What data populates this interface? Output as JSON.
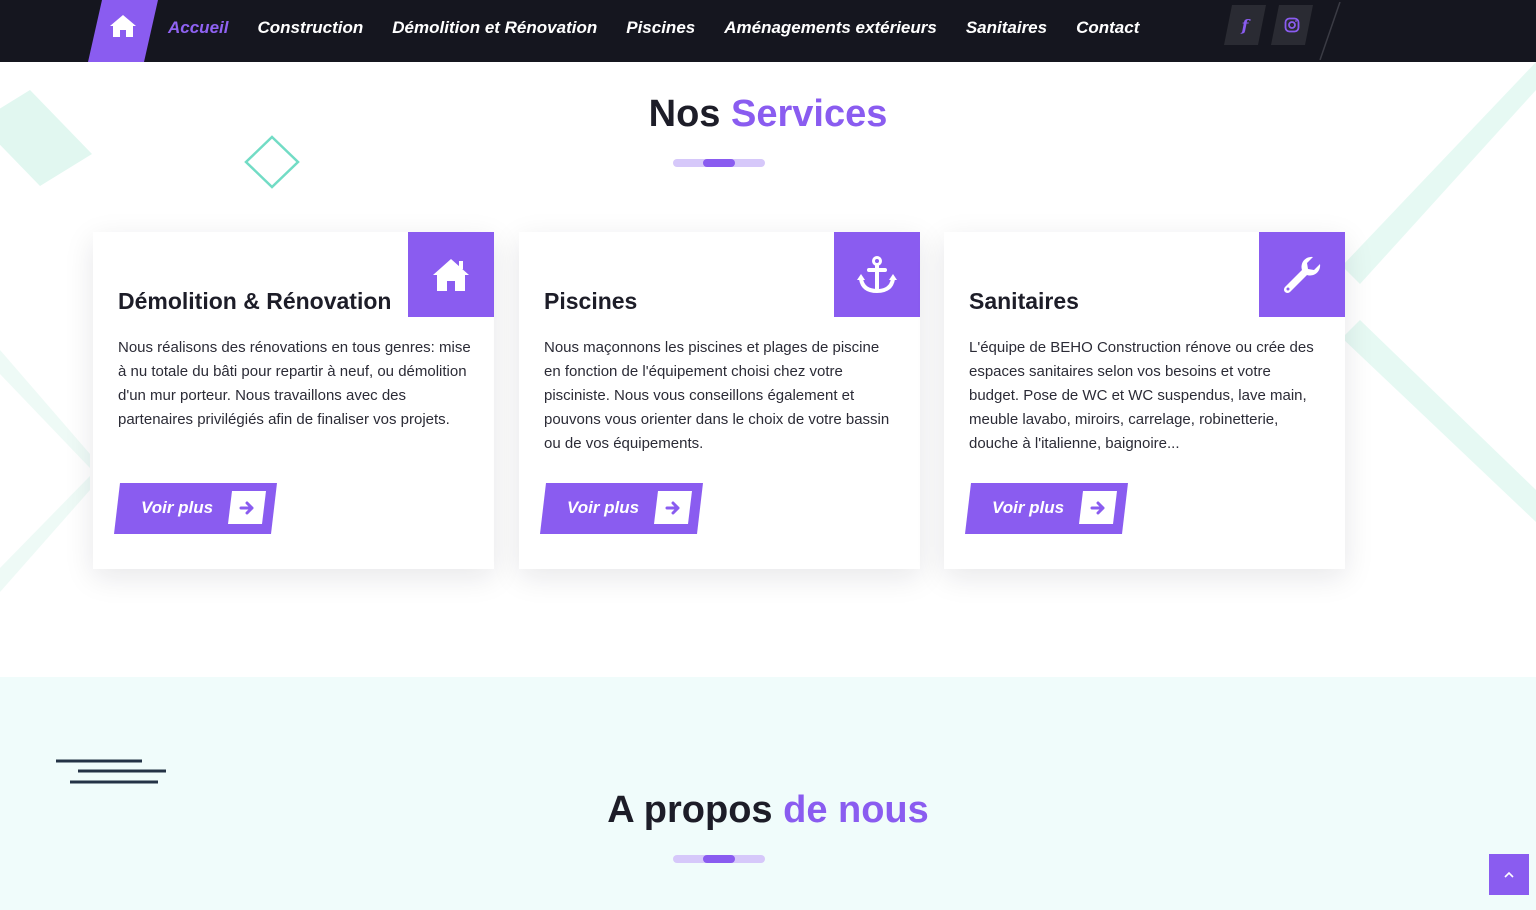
{
  "nav": {
    "home_icon": "home-icon",
    "links": [
      {
        "label": "Accueil"
      },
      {
        "label": "Construction"
      },
      {
        "label": "Démolition et Rénovation"
      },
      {
        "label": "Piscines"
      },
      {
        "label": "Aménagements extérieurs"
      },
      {
        "label": "Sanitaires"
      },
      {
        "label": "Contact"
      }
    ],
    "active": "Accueil",
    "social": {
      "facebook_glyph": "f",
      "facebook_icon": "facebook-icon",
      "instagram_icon": "instagram-icon"
    }
  },
  "services": {
    "title_plain": "Nos",
    "title_highlight": "Services",
    "cards": [
      {
        "title": "Démolition & Rénovation",
        "icon": "house-icon",
        "text": "Nous réalisons des rénovations en tous genres: mise à nu totale du bâti pour repartir à neuf, ou démolition d'un mur porteur. Nous travaillons avec des partenaires privilégiés afin de finaliser vos projets.",
        "button": "Voir plus"
      },
      {
        "title": "Piscines",
        "icon": "anchor-icon",
        "text": "Nous maçonnons les piscines et plages de piscine en fonction de l'équipement choisi chez votre pisciniste. Nous vous conseillons également et pouvons vous orienter dans le choix de votre bassin ou de vos équipements.",
        "button": "Voir plus"
      },
      {
        "title": "Sanitaires",
        "icon": "wrench-icon",
        "text": "L'équipe de BEHO Construction rénove ou crée des espaces sanitaires selon vos besoins et votre budget. Pose de WC et WC suspendus, lave main, meuble lavabo, miroirs, carrelage, robinetterie, douche à l'italienne, baignoire...",
        "button": "Voir plus"
      }
    ]
  },
  "about": {
    "title_plain": "A propos",
    "title_highlight": "de nous"
  },
  "colors": {
    "accent": "#8a5cf0",
    "nav_bg": "#15161f",
    "mint": "#e3f8f2",
    "about_bg": "#f0fcfb"
  },
  "scroll_top_icon": "chevron-up-icon"
}
